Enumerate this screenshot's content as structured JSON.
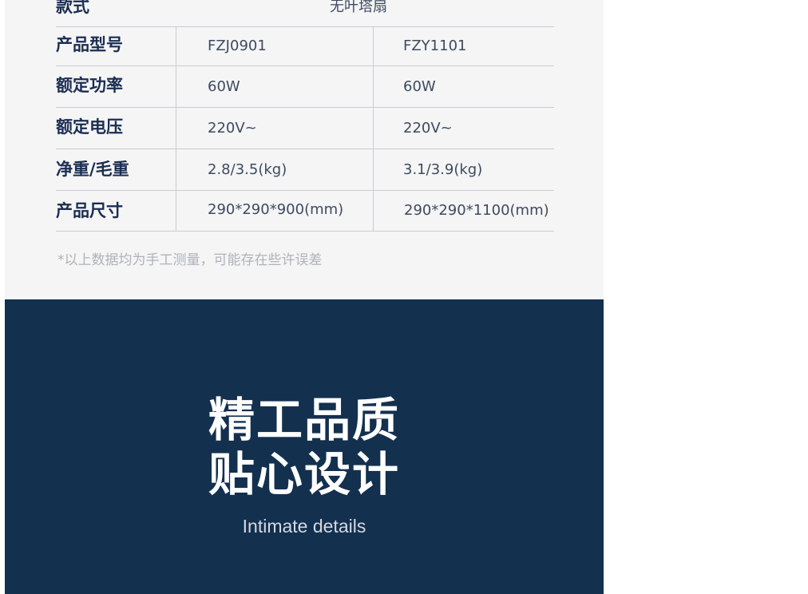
{
  "spec_table": {
    "style_row": {
      "label": "款式",
      "value": "无叶塔扇"
    },
    "rows": [
      {
        "label": "产品型号",
        "values": [
          "FZJ0901",
          "FZY1101"
        ]
      },
      {
        "label": "额定功率",
        "values": [
          "60W",
          "60W"
        ]
      },
      {
        "label": "额定电压",
        "values": [
          "220V~",
          "220V~"
        ]
      },
      {
        "label": "净重/毛重",
        "values": [
          "2.8/3.5(kg)",
          "3.1/3.9(kg)"
        ]
      },
      {
        "label": "产品尺寸",
        "values": [
          "290*290*900(mm)",
          "290*290*1100(mm)"
        ]
      }
    ],
    "disclaimer": "*以上数据均为手工测量，可能存在些许误差"
  },
  "feature_banner": {
    "headline_line1": "精工品质",
    "headline_line2": "贴心设计",
    "subtitle": "Intimate details"
  },
  "colors": {
    "banner_background": "#13304f",
    "spec_background": "#f5f5f5",
    "label_text": "#1b2d52"
  }
}
